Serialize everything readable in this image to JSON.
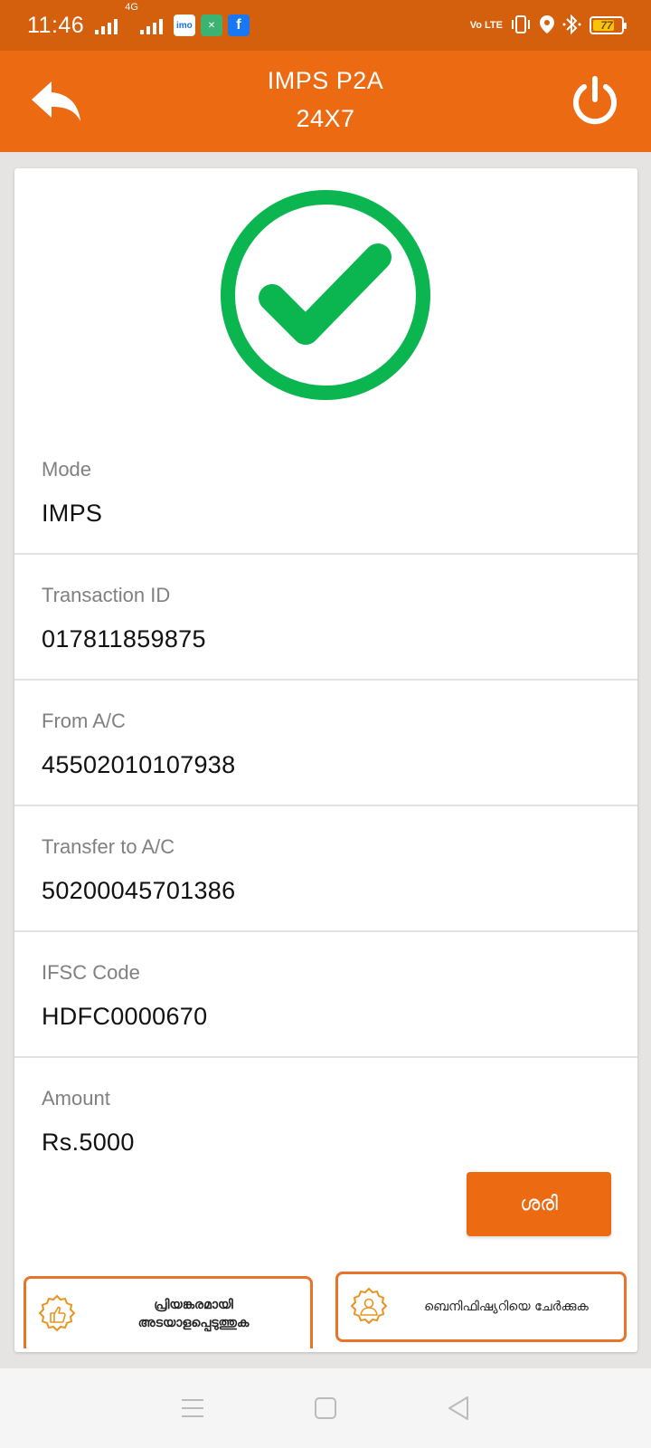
{
  "status_bar": {
    "time": "11:46",
    "network_label": "4G",
    "volte_label": "Vo LTE",
    "battery_level": "77",
    "battery_fraction": 0.77,
    "app_icons": [
      "imo-icon",
      "mi-app-icon",
      "facebook-icon"
    ]
  },
  "app_bar": {
    "title_line1": "IMPS P2A",
    "title_line2": "24X7",
    "back_icon": "reply-arrow-icon",
    "power_icon": "power-icon",
    "color": "#ec6a12"
  },
  "success": {
    "icon": "check-circle-icon",
    "color": "#0bb54f"
  },
  "details": [
    {
      "label": "Mode",
      "value": "IMPS"
    },
    {
      "label": "Transaction ID",
      "value": "017811859875"
    },
    {
      "label": "From A/C",
      "value": "45502010107938"
    },
    {
      "label": "Transfer to A/C",
      "value": "50200045701386"
    },
    {
      "label": "IFSC Code",
      "value": "HDFC0000670"
    },
    {
      "label": "Amount",
      "value": "Rs.5000"
    }
  ],
  "ok_button": {
    "label": "ശരി"
  },
  "actions": {
    "favourite": {
      "label_line1": "പ്രിയങ്കരമായി",
      "label_line2": "അടയാളപ്പെടുത്തുക",
      "icon": "thumbs-up-badge-icon"
    },
    "add_beneficiary": {
      "label": "ബെനിഫിഷ്യറിയെ ചേർക്കുക",
      "icon": "person-badge-icon"
    }
  },
  "nav_bar": {
    "items": [
      "menu-icon",
      "home-square-icon",
      "back-triangle-icon"
    ]
  }
}
